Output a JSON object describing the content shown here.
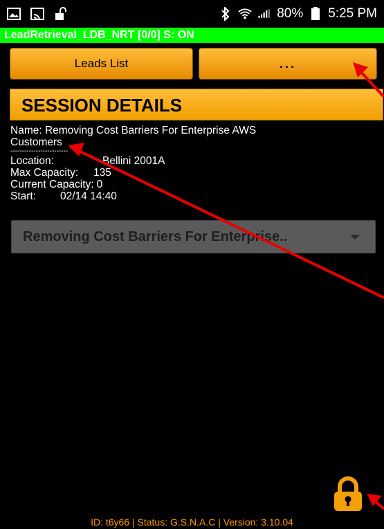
{
  "status_bar": {
    "icons_left": [
      "image-icon",
      "cast-icon",
      "unlock-icon"
    ],
    "icons_right": [
      "bluetooth-icon",
      "wifi-icon",
      "signal-icon",
      "battery-icon"
    ],
    "battery": "80%",
    "time": "5:25 PM"
  },
  "app_title": "LeadRetrieval_LDB_NRT [0/0] S: ON",
  "buttons": {
    "leads_list": "Leads List",
    "more": "..."
  },
  "section_header": "SESSION DETAILS",
  "details": {
    "name_line1": "Name: Removing Cost Barriers For Enterprise AWS",
    "name_line2": "Customers",
    "separator": "-------------------------",
    "location_label": "Location:",
    "location_value": "Bellini 2001A",
    "max_capacity_label": "Max Capacity:",
    "max_capacity_value": "135",
    "current_capacity_label": "Current Capacity:",
    "current_capacity_value": "0",
    "start_label": "Start:",
    "start_value": "02/14 14:40"
  },
  "session_dropdown": {
    "selected": "Removing Cost Barriers For Enterprise.."
  },
  "footer": "ID: t6y66 | Status: G.S.N.A.C | Version: 3.10.04",
  "colors": {
    "accent_orange": "#f5a000",
    "title_green": "#00ff00",
    "footer_text": "#ff9800",
    "arrow_red": "#e60000"
  }
}
